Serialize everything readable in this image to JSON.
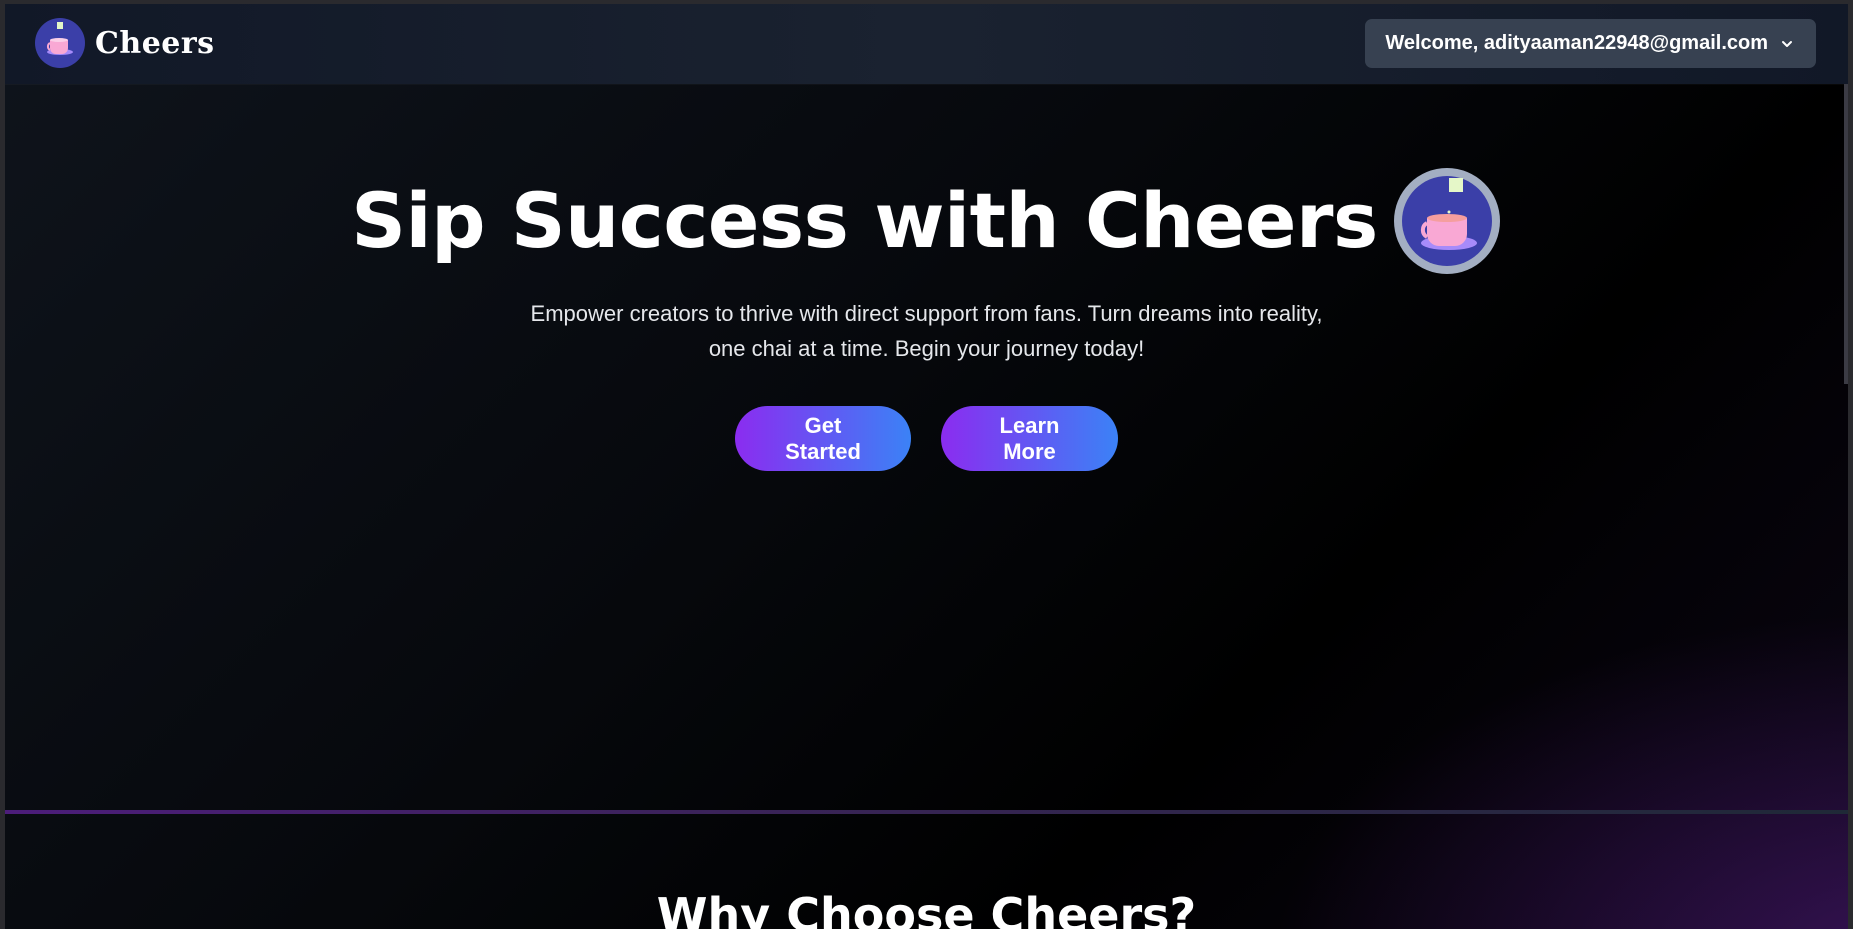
{
  "navbar": {
    "brand_name": "Cheers",
    "logo_icon": "chai-cup-icon",
    "welcome_label": "Welcome, adityaaman22948@gmail.com",
    "dropdown_icon": "chevron-down-icon"
  },
  "hero": {
    "title": "Sip Success with Cheers",
    "logo_icon": "chai-cup-icon",
    "subtitle": "Empower creators to thrive with direct support from fans. Turn dreams into reality, one chai at a time. Begin your journey today!",
    "buttons": {
      "get_started": "Get Started",
      "learn_more": "Learn More"
    }
  },
  "features": {
    "title": "Why Choose Cheers?"
  },
  "colors": {
    "accent_start": "#8b2cf0",
    "accent_end": "#3b82f6",
    "navbar_bg": "#111827",
    "welcome_bg": "#374151",
    "logo_circle": "#3b3fa8",
    "cup": "#f9a8d4"
  }
}
